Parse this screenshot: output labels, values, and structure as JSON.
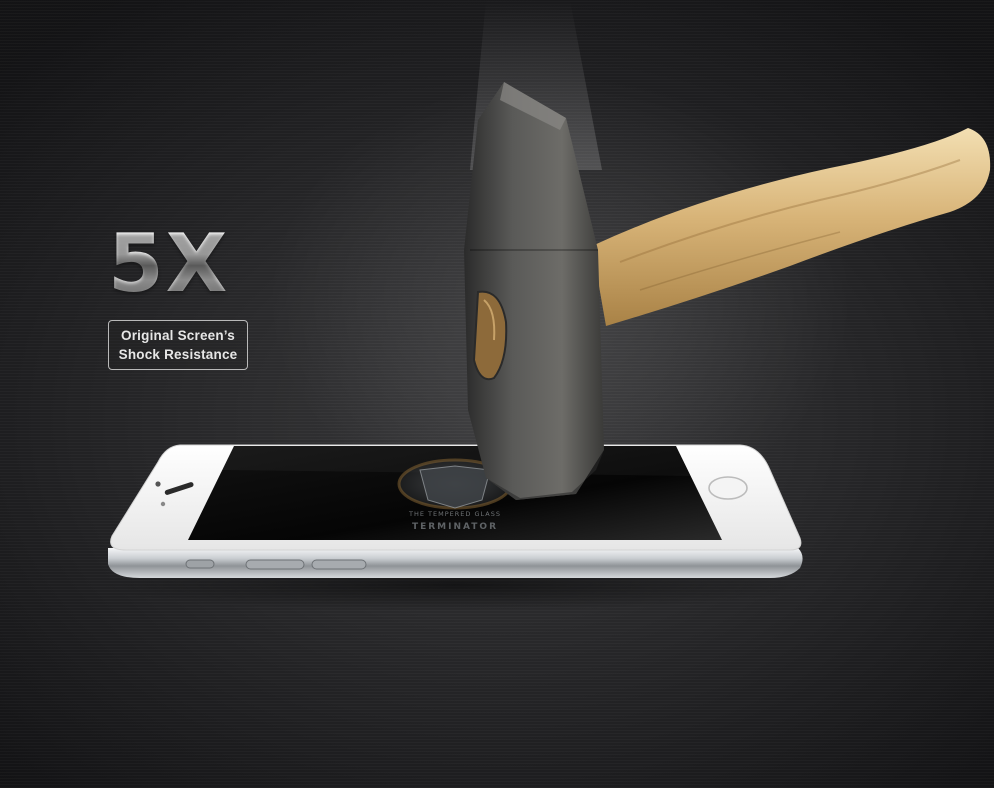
{
  "badge": {
    "multiplier": "5X",
    "caption_line1": "Original Screen’s",
    "caption_line2": "Shock Resistance"
  },
  "screen_logo": {
    "subtitle": "THE TEMPERED GLASS",
    "title": "TERMINATOR"
  },
  "colors": {
    "background": "#252527",
    "phone_body": "#f2f2f2",
    "phone_frame": "#b8bcc0",
    "screen": "#0d0d0d",
    "hammer_head": "#4a4a4a",
    "hammer_handle": "#d9b67a"
  }
}
